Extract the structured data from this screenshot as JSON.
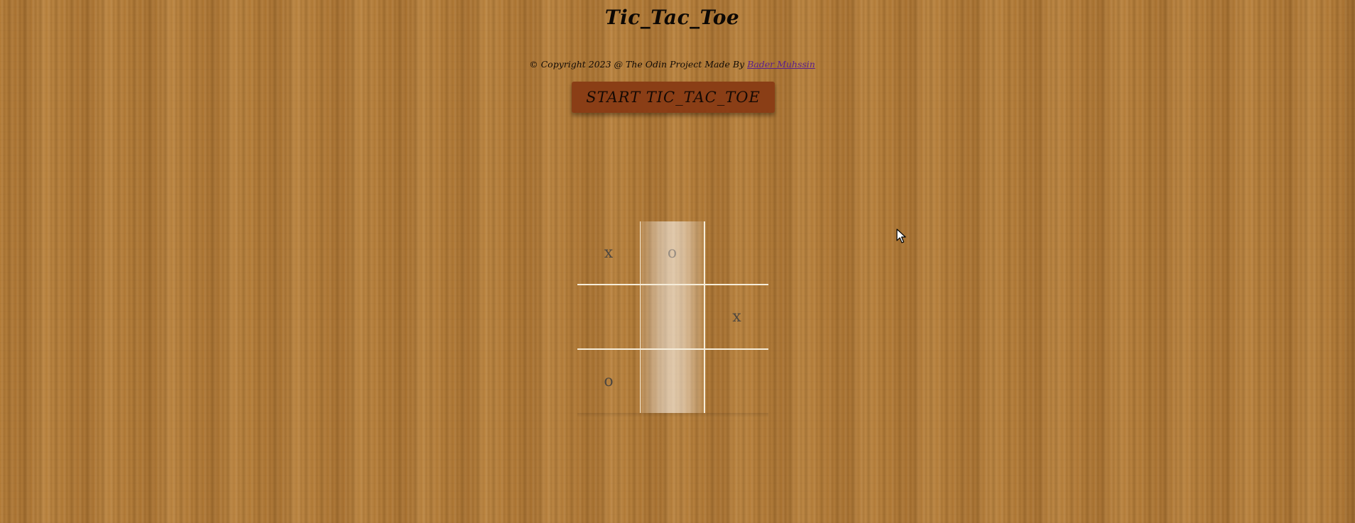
{
  "page": {
    "title": "Tic_Tac_Toe"
  },
  "footer": {
    "copyright_text": "© Copyright 2023 @ The Odin Project Made By ",
    "author_link": "Bader Muhssin"
  },
  "start_button": {
    "label": "START TIC_TAC_TOE"
  },
  "board": {
    "cells": [
      [
        "x",
        "o",
        ""
      ],
      [
        "",
        "",
        "x"
      ],
      [
        "o",
        "",
        ""
      ]
    ],
    "hovered_column": 1
  },
  "colors": {
    "background": "#b27a35",
    "button": "#8a3e16",
    "grid_lines": "#f5ecd9",
    "mark": "#4f4840",
    "link": "#5a1f8c"
  },
  "icons": {
    "cursor": "mouse-pointer-icon"
  }
}
